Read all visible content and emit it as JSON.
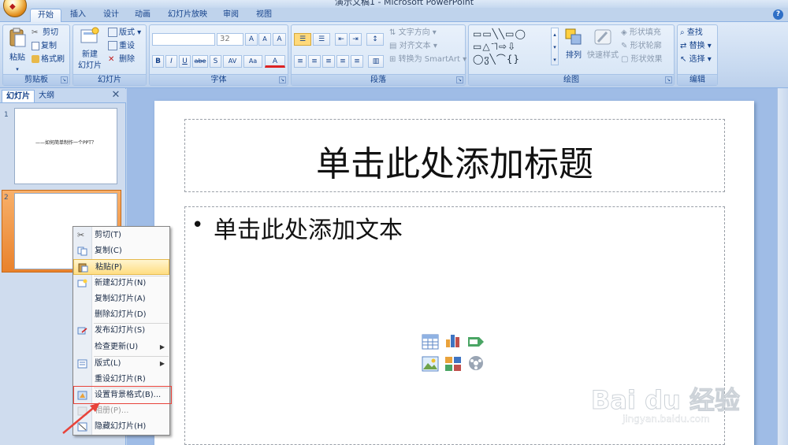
{
  "window": {
    "title": "演示文稿1 - Microsoft PowerPoint"
  },
  "tabs": [
    "开始",
    "插入",
    "设计",
    "动画",
    "幻灯片放映",
    "审阅",
    "视图"
  ],
  "active_tab": "开始",
  "ribbon": {
    "clipboard": {
      "paste": "粘贴",
      "cut": "剪切",
      "copy": "复制",
      "format_painter": "格式刷",
      "label": "剪贴板"
    },
    "slides": {
      "new_slide_line1": "新建",
      "new_slide_line2": "幻灯片",
      "layout": "版式",
      "reset": "重设",
      "delete": "删除",
      "label": "幻灯片"
    },
    "font": {
      "font_size": "32",
      "bold": "B",
      "italic": "I",
      "underline": "U",
      "strike": "abe",
      "shadow": "S",
      "spacing": "AV",
      "case": "Aa",
      "grow": "A",
      "shrink": "A",
      "clear": "A",
      "color": "A",
      "label": "字体"
    },
    "paragraph": {
      "text_direction": "文字方向",
      "align_text": "对齐文本",
      "smartart": "转换为 SmartArt",
      "label": "段落"
    },
    "drawing": {
      "arrange": "排列",
      "quick_styles": "快速样式",
      "shape_fill": "形状填充",
      "shape_outline": "形状轮廓",
      "shape_effects": "形状效果",
      "label": "绘图"
    },
    "editing": {
      "find": "查找",
      "replace": "替换",
      "select": "选择",
      "label": "编辑"
    }
  },
  "left_panel": {
    "tabs": [
      "幻灯片",
      "大纲"
    ],
    "slides": [
      {
        "number": "1",
        "text": "——如何简单制作一个PPT？"
      },
      {
        "number": "2",
        "text": ""
      }
    ]
  },
  "slide": {
    "title_placeholder": "单击此处添加标题",
    "body_placeholder": "单击此处添加文本",
    "bullet": "•"
  },
  "context_menu": {
    "items": [
      {
        "label": "剪切(T)",
        "icon": "scissors-icon",
        "enabled": true,
        "submenu": false
      },
      {
        "label": "复制(C)",
        "icon": "copy-icon",
        "enabled": true,
        "submenu": false
      },
      {
        "label": "粘贴(P)",
        "icon": "paste-icon",
        "enabled": true,
        "submenu": false,
        "highlighted": true
      },
      {
        "label": "新建幻灯片(N)",
        "icon": "new-slide-icon",
        "enabled": true,
        "submenu": false
      },
      {
        "label": "复制幻灯片(A)",
        "icon": "",
        "enabled": true,
        "submenu": false
      },
      {
        "label": "删除幻灯片(D)",
        "icon": "",
        "enabled": true,
        "submenu": false
      },
      {
        "label": "发布幻灯片(S)",
        "icon": "publish-icon",
        "enabled": true,
        "submenu": false
      },
      {
        "label": "检查更新(U)",
        "icon": "",
        "enabled": true,
        "submenu": true
      },
      {
        "label": "版式(L)",
        "icon": "layout-icon",
        "enabled": true,
        "submenu": true
      },
      {
        "label": "重设幻灯片(R)",
        "icon": "",
        "enabled": true,
        "submenu": false
      },
      {
        "label": "设置背景格式(B)...",
        "icon": "format-background-icon",
        "enabled": true,
        "submenu": false
      },
      {
        "label": "相册(P)...",
        "icon": "photo-album-icon",
        "enabled": false,
        "submenu": false
      },
      {
        "label": "隐藏幻灯片(H)",
        "icon": "hide-slide-icon",
        "enabled": true,
        "submenu": false
      }
    ]
  },
  "watermark": {
    "brand": "Bai du 经验",
    "url": "jingyan.baidu.com"
  },
  "colors": {
    "accent_highlight": "#ffdd82",
    "annotation_red": "#e8433a"
  }
}
